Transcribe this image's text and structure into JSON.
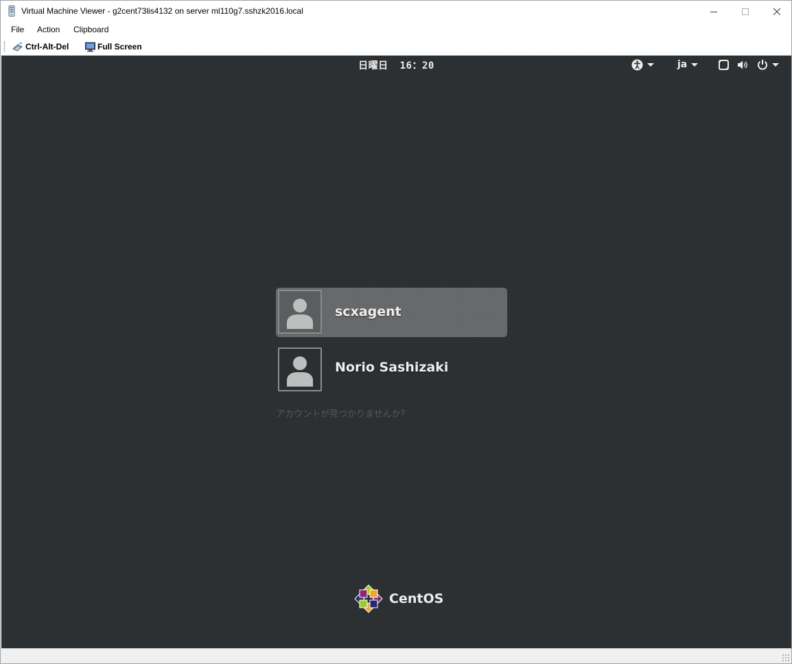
{
  "window": {
    "title": "Virtual Machine Viewer - g2cent73lis4132 on server ml110g7.sshzk2016.local"
  },
  "menu": {
    "items": [
      {
        "label": "File"
      },
      {
        "label": "Action"
      },
      {
        "label": "Clipboard"
      }
    ]
  },
  "toolbar": {
    "ctrl_alt_del_label": "Ctrl-Alt-Del",
    "full_screen_label": "Full Screen"
  },
  "top_panel": {
    "day": "日曜日",
    "time": "16：20",
    "language": "ja"
  },
  "login": {
    "users": [
      {
        "name": "scxagent",
        "selected": true
      },
      {
        "name": "Norio Sashizaki",
        "selected": false
      }
    ],
    "not_listed": "アカウントが見つかりませんか?"
  },
  "branding": {
    "logo_text": "CentOS"
  },
  "colors": {
    "screen_bg": "#2c2f31",
    "panel_text": "#eeeeec",
    "selected_row": "#6a6c6e"
  }
}
